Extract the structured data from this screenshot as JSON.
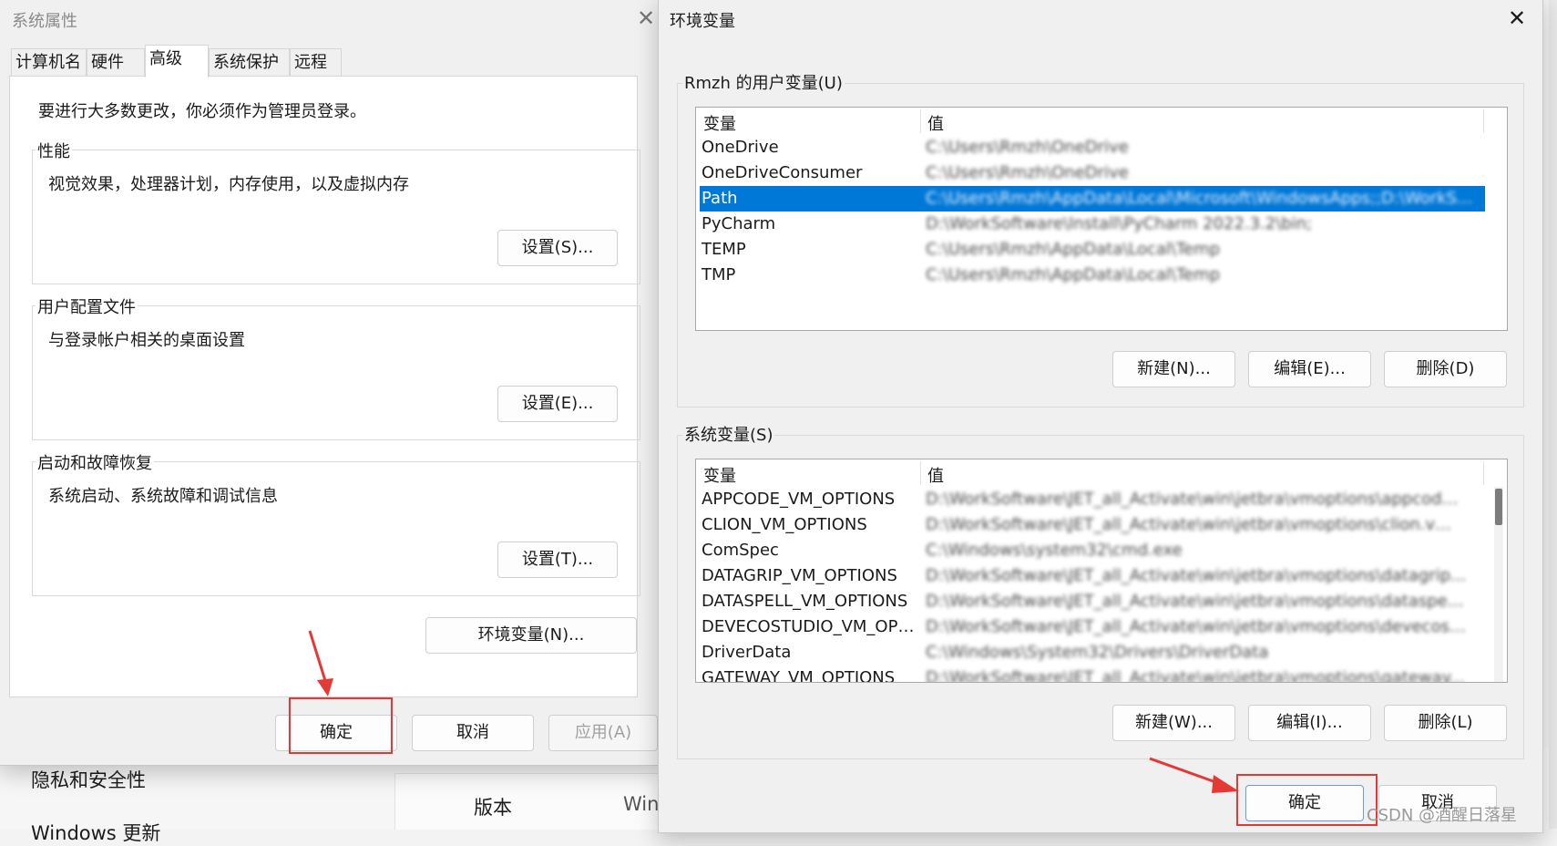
{
  "background": {
    "items": [
      "隐私和安全性",
      "Windows 更新"
    ],
    "version_label": "版本",
    "win_label": "Win"
  },
  "system_properties": {
    "title": "系统属性",
    "tabs": [
      "计算机名",
      "硬件",
      "高级",
      "系统保护",
      "远程"
    ],
    "active_tab": "高级",
    "admin_notice": "要进行大多数更改，你必须作为管理员登录。",
    "performance": {
      "label": "性能",
      "description": "视觉效果，处理器计划，内存使用，以及虚拟内存",
      "button": "设置(S)..."
    },
    "user_profiles": {
      "label": "用户配置文件",
      "description": "与登录帐户相关的桌面设置",
      "button": "设置(E)..."
    },
    "startup_recovery": {
      "label": "启动和故障恢复",
      "description": "系统启动、系统故障和调试信息",
      "button": "设置(T)..."
    },
    "env_button": "环境变量(N)...",
    "ok_button": "确定",
    "cancel_button": "取消",
    "apply_button": "应用(A)"
  },
  "env_vars": {
    "title": "环境变量",
    "user_section": {
      "label": "Rmzh 的用户变量(U)",
      "col_name": "变量",
      "col_value": "值",
      "selected": "Path",
      "rows": [
        {
          "name": "OneDrive",
          "value": "C:\\Users\\Rmzh\\OneDrive"
        },
        {
          "name": "OneDriveConsumer",
          "value": "C:\\Users\\Rmzh\\OneDrive"
        },
        {
          "name": "Path",
          "value": "C:\\Users\\Rmzh\\AppData\\Local\\Microsoft\\WindowsApps;;D:\\WorkS..."
        },
        {
          "name": "PyCharm",
          "value": "D:\\WorkSoftware\\Install\\PyCharm 2022.3.2\\bin;"
        },
        {
          "name": "TEMP",
          "value": "C:\\Users\\Rmzh\\AppData\\Local\\Temp"
        },
        {
          "name": "TMP",
          "value": "C:\\Users\\Rmzh\\AppData\\Local\\Temp"
        }
      ],
      "new_button": "新建(N)...",
      "edit_button": "编辑(E)...",
      "delete_button": "删除(D)"
    },
    "system_section": {
      "label": "系统变量(S)",
      "col_name": "变量",
      "col_value": "值",
      "rows": [
        {
          "name": "APPCODE_VM_OPTIONS",
          "value": "D:\\WorkSoftware\\JET_all_Activate\\win\\jetbra\\vmoptions\\appcode..."
        },
        {
          "name": "CLION_VM_OPTIONS",
          "value": "D:\\WorkSoftware\\JET_all_Activate\\win\\jetbra\\vmoptions\\clion.vmo..."
        },
        {
          "name": "ComSpec",
          "value": "C:\\Windows\\system32\\cmd.exe"
        },
        {
          "name": "DATAGRIP_VM_OPTIONS",
          "value": "D:\\WorkSoftware\\JET_all_Activate\\win\\jetbra\\vmoptions\\datagrip..."
        },
        {
          "name": "DATASPELL_VM_OPTIONS",
          "value": "D:\\WorkSoftware\\JET_all_Activate\\win\\jetbra\\vmoptions\\dataspell..."
        },
        {
          "name": "DEVECOSTUDIO_VM_OPTIO...",
          "value": "D:\\WorkSoftware\\JET_all_Activate\\win\\jetbra\\vmoptions\\devecost..."
        },
        {
          "name": "DriverData",
          "value": "C:\\Windows\\System32\\Drivers\\DriverData"
        },
        {
          "name": "GATEWAY_VM_OPTIONS",
          "value": "D:\\WorkSoftware\\JET_all_Activate\\win\\jetbra\\vmoptions\\gateway..."
        }
      ],
      "new_button": "新建(W)...",
      "edit_button": "编辑(I)...",
      "delete_button": "删除(L)"
    },
    "ok_button": "确定",
    "cancel_button": "取消"
  },
  "watermark": "CSDN @酒醒日落星",
  "colors": {
    "selection": "#0078d7",
    "highlight_box": "#e53935",
    "arrow": "#e53935"
  }
}
